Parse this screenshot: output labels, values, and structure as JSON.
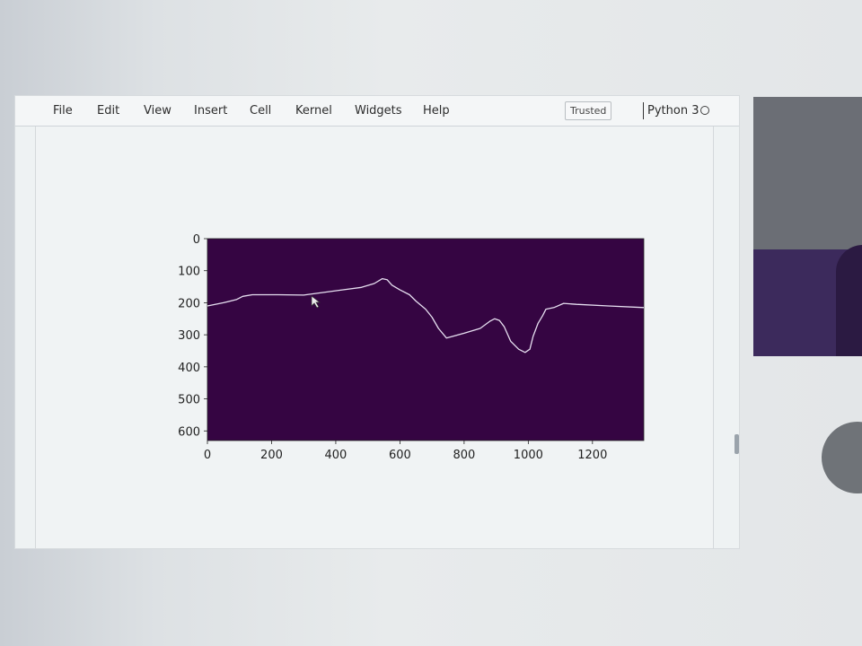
{
  "menubar": {
    "items": [
      "File",
      "Edit",
      "View",
      "Insert",
      "Cell",
      "Kernel",
      "Widgets",
      "Help"
    ],
    "trusted_label": "Trusted",
    "kernel_name": "Python 3"
  },
  "chart_data": {
    "type": "image",
    "colormap": "viridis",
    "background_color": "#350542",
    "line_color": "#e6dff0",
    "xlim": [
      0,
      1360
    ],
    "ylim": [
      630,
      0
    ],
    "y_inverted": true,
    "xticks": [
      "0",
      "200",
      "400",
      "600",
      "800",
      "1000",
      "1200"
    ],
    "xtick_values": [
      0,
      200,
      400,
      600,
      800,
      1000,
      1200
    ],
    "yticks": [
      "0",
      "100",
      "200",
      "300",
      "400",
      "500",
      "600"
    ],
    "ytick_values": [
      0,
      100,
      200,
      300,
      400,
      500,
      600
    ],
    "edge_points": [
      [
        0,
        210
      ],
      [
        50,
        200
      ],
      [
        90,
        190
      ],
      [
        110,
        180
      ],
      [
        140,
        175
      ],
      [
        220,
        175
      ],
      [
        300,
        176
      ],
      [
        360,
        168
      ],
      [
        420,
        160
      ],
      [
        480,
        152
      ],
      [
        520,
        140
      ],
      [
        545,
        125
      ],
      [
        560,
        128
      ],
      [
        575,
        145
      ],
      [
        600,
        160
      ],
      [
        630,
        175
      ],
      [
        650,
        195
      ],
      [
        680,
        220
      ],
      [
        700,
        245
      ],
      [
        720,
        280
      ],
      [
        745,
        310
      ],
      [
        800,
        295
      ],
      [
        850,
        280
      ],
      [
        880,
        258
      ],
      [
        895,
        250
      ],
      [
        910,
        255
      ],
      [
        925,
        275
      ],
      [
        945,
        320
      ],
      [
        970,
        345
      ],
      [
        990,
        355
      ],
      [
        1005,
        345
      ],
      [
        1015,
        305
      ],
      [
        1030,
        265
      ],
      [
        1045,
        240
      ],
      [
        1055,
        220
      ],
      [
        1080,
        215
      ],
      [
        1110,
        202
      ],
      [
        1150,
        205
      ],
      [
        1250,
        210
      ],
      [
        1360,
        215
      ]
    ]
  }
}
